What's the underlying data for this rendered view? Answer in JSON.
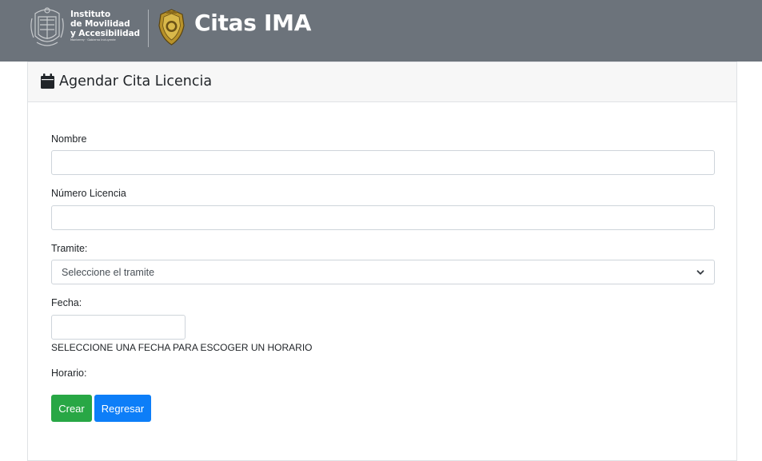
{
  "header": {
    "institute_line1": "Instituto",
    "institute_line2": "de Movilidad",
    "institute_line3": "y Accesibilidad",
    "institute_tagline": "Monterrey · Gobierno Incluyente",
    "app_title": "Citas IMA",
    "bg_color": "#6c737b"
  },
  "card": {
    "icon": "calendar-icon",
    "title": "Agendar Cita Licencia"
  },
  "form": {
    "nombre_label": "Nombre",
    "nombre_value": "",
    "licencia_label": "Número Licencia",
    "licencia_value": "",
    "tramite_label": "Tramite:",
    "tramite_selected": "Seleccione el tramite",
    "fecha_label": "Fecha:",
    "fecha_value": "",
    "fecha_hint": "SELECCIONE UNA FECHA PARA ESCOGER UN HORARIO",
    "horario_label": "Horario:"
  },
  "buttons": {
    "create_label": "Crear",
    "back_label": "Regresar",
    "create_color": "#28a745",
    "back_color": "#0d7ef8"
  }
}
